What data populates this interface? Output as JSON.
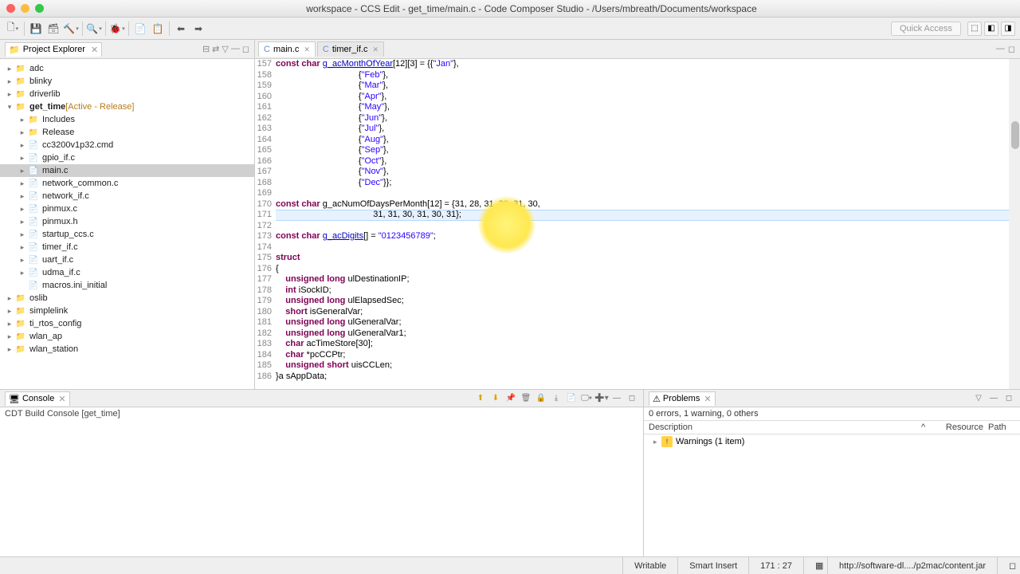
{
  "title": "workspace - CCS Edit - get_time/main.c - Code Composer Studio - /Users/mbreath/Documents/workspace",
  "quick_access": "Quick Access",
  "explorer": {
    "title": "Project Explorer",
    "items": [
      {
        "d": 0,
        "tw": "▸",
        "ic": "fold",
        "lbl": "adc"
      },
      {
        "d": 0,
        "tw": "▸",
        "ic": "fold",
        "lbl": "blinky"
      },
      {
        "d": 0,
        "tw": "▸",
        "ic": "fold",
        "lbl": "driverlib"
      },
      {
        "d": 0,
        "tw": "▾",
        "ic": "fold",
        "lbl": "get_time",
        "extra": "[Active - Release]",
        "bold": true
      },
      {
        "d": 1,
        "tw": "▸",
        "ic": "fold",
        "lbl": "Includes"
      },
      {
        "d": 1,
        "tw": "▸",
        "ic": "fold",
        "lbl": "Release"
      },
      {
        "d": 1,
        "tw": "▸",
        "ic": "cmd",
        "lbl": "cc3200v1p32.cmd"
      },
      {
        "d": 1,
        "tw": "▸",
        "ic": "cfile",
        "lbl": "gpio_if.c"
      },
      {
        "d": 1,
        "tw": "▸",
        "ic": "cfile",
        "lbl": "main.c",
        "sel": true
      },
      {
        "d": 1,
        "tw": "▸",
        "ic": "cfile",
        "lbl": "network_common.c"
      },
      {
        "d": 1,
        "tw": "▸",
        "ic": "cfile",
        "lbl": "network_if.c"
      },
      {
        "d": 1,
        "tw": "▸",
        "ic": "cfile",
        "lbl": "pinmux.c"
      },
      {
        "d": 1,
        "tw": "▸",
        "ic": "cfile",
        "lbl": "pinmux.h"
      },
      {
        "d": 1,
        "tw": "▸",
        "ic": "cfile",
        "lbl": "startup_ccs.c"
      },
      {
        "d": 1,
        "tw": "▸",
        "ic": "cfile",
        "lbl": "timer_if.c"
      },
      {
        "d": 1,
        "tw": "▸",
        "ic": "cfile",
        "lbl": "uart_if.c"
      },
      {
        "d": 1,
        "tw": "▸",
        "ic": "cfile",
        "lbl": "udma_if.c"
      },
      {
        "d": 1,
        "tw": "",
        "ic": "cfg",
        "lbl": "macros.ini_initial"
      },
      {
        "d": 0,
        "tw": "▸",
        "ic": "fold",
        "lbl": "oslib"
      },
      {
        "d": 0,
        "tw": "▸",
        "ic": "fold",
        "lbl": "simplelink"
      },
      {
        "d": 0,
        "tw": "▸",
        "ic": "fold",
        "lbl": "ti_rtos_config"
      },
      {
        "d": 0,
        "tw": "▸",
        "ic": "fold",
        "lbl": "wlan_ap"
      },
      {
        "d": 0,
        "tw": "▸",
        "ic": "fold",
        "lbl": "wlan_station"
      }
    ]
  },
  "tabs": [
    {
      "label": "main.c",
      "active": true
    },
    {
      "label": "timer_if.c",
      "active": false
    }
  ],
  "code": {
    "start": 157,
    "lines": [
      "<span class='kw'>const</span> <span class='kw'>char</span> <span class='id-u'>g_acMonthOfYear</span>[12][3] = {{<span class='str'>\"Jan\"</span>},",
      "                                  {<span class='str'>\"Feb\"</span>},",
      "                                  {<span class='str'>\"Mar\"</span>},",
      "                                  {<span class='str'>\"Apr\"</span>},",
      "                                  {<span class='str'>\"May\"</span>},",
      "                                  {<span class='str'>\"Jun\"</span>},",
      "                                  {<span class='str'>\"Jul\"</span>},",
      "                                  {<span class='str'>\"Aug\"</span>},",
      "                                  {<span class='str'>\"Sep\"</span>},",
      "                                  {<span class='str'>\"Oct\"</span>},",
      "                                  {<span class='str'>\"Nov\"</span>},",
      "                                  {<span class='str'>\"Dec\"</span>}};",
      "",
      "<span class='kw'>const</span> <span class='kw'>char</span> g_acNumOfDaysPerMonth[12] = {31, 28, 31, 30, 31, 30,",
      "                                        31, 31, 30, 31, 30, 31};",
      "",
      "<span class='kw'>const</span> <span class='kw'>char</span> <span class='id-u'>g_acDigits</span>[] = <span class='str'>\"0123456789\"</span>;",
      "",
      "<span class='kw'>struct</span>",
      "{",
      "    <span class='kw'>unsigned</span> <span class='kw'>long</span> ulDestinationIP;",
      "    <span class='kw'>int</span> iSockID;",
      "    <span class='kw'>unsigned</span> <span class='kw'>long</span> ulElapsedSec;",
      "    <span class='kw'>short</span> isGeneralVar;",
      "    <span class='kw'>unsigned</span> <span class='kw'>long</span> ulGeneralVar;",
      "    <span class='kw'>unsigned</span> <span class='kw'>long</span> ulGeneralVar1;",
      "    <span class='kw'>char</span> acTimeStore[30];",
      "    <span class='kw'>char</span> *pcCCPtr;",
      "    <span class='kw'>unsigned</span> <span class='kw'>short</span> uisCCLen;",
      "}a sAppData;"
    ],
    "hl_index": 14
  },
  "console": {
    "title": "Console",
    "sub": "CDT Build Console [get_time]"
  },
  "problems": {
    "title": "Problems",
    "status": "0 errors, 1 warning, 0 others",
    "cols": [
      "Description",
      "Resource",
      "Path"
    ],
    "row": "Warnings (1 item)"
  },
  "status": {
    "writable": "Writable",
    "insert": "Smart Insert",
    "pos": "171 : 27",
    "link": "http://software-dl..../p2mac/content.jar"
  }
}
